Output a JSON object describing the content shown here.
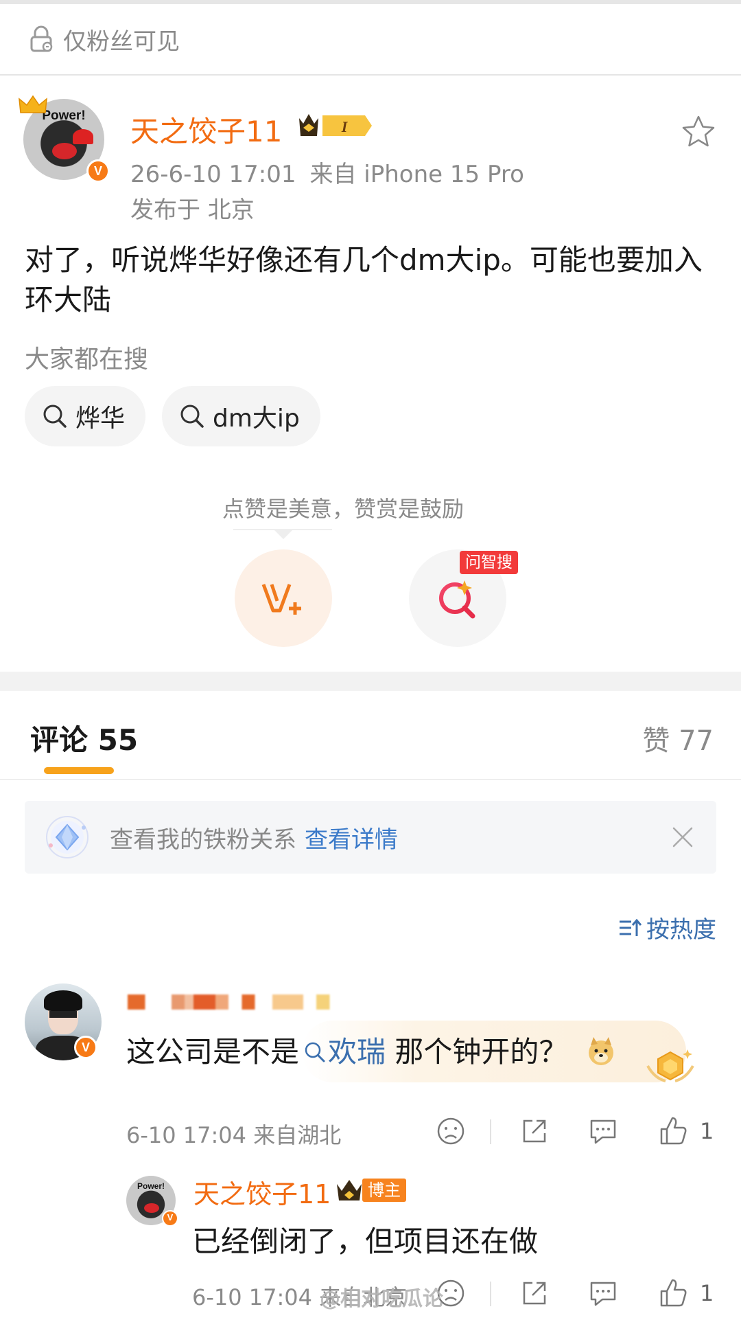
{
  "visibility": {
    "icon": "lock-icon",
    "label": "仅粉丝可见"
  },
  "post": {
    "author": "天之饺子11",
    "user_level_badge": "I",
    "time": "26-6-10 17:01",
    "source": "来自 iPhone 15 Pro",
    "location": "发布于 北京",
    "text": "对了，听说烨华好像还有几个dm大ip。可能也要加入环大陆",
    "search_hint": "大家都在搜",
    "search_chips": [
      {
        "icon": "search-icon",
        "label": "烨华"
      },
      {
        "icon": "search-icon",
        "label": "dm大ip"
      }
    ],
    "reward_tip": "点赞是美意，赞赏是鼓励",
    "ai_search_tag": "问智搜"
  },
  "avatar_text": "Power!",
  "tabs": {
    "comments": "评论 55",
    "likes": "赞 77"
  },
  "fan_banner": {
    "text": "查看我的铁粉关系",
    "link": "查看详情"
  },
  "sort": {
    "label": "按热度"
  },
  "comments": [
    {
      "text_before": "这公司是不是",
      "keyword": "欢瑞",
      "text_after": "那个钟开的？",
      "time_location": "6-10 17:04  来自湖北",
      "like_count": "1"
    }
  ],
  "reply": {
    "author": "天之饺子11",
    "tag": "博主",
    "text": "已经倒闭了，但项目还在做",
    "time_location": "6-10 17:04  来自北京",
    "like_count": "1"
  },
  "watermark": "@相对吃瓜论",
  "colors": {
    "accent_orange": "#f26b11",
    "link_blue": "#3b6fae",
    "tab_underline": "#f7a21b",
    "ai_tag_red": "#f23a3a"
  }
}
